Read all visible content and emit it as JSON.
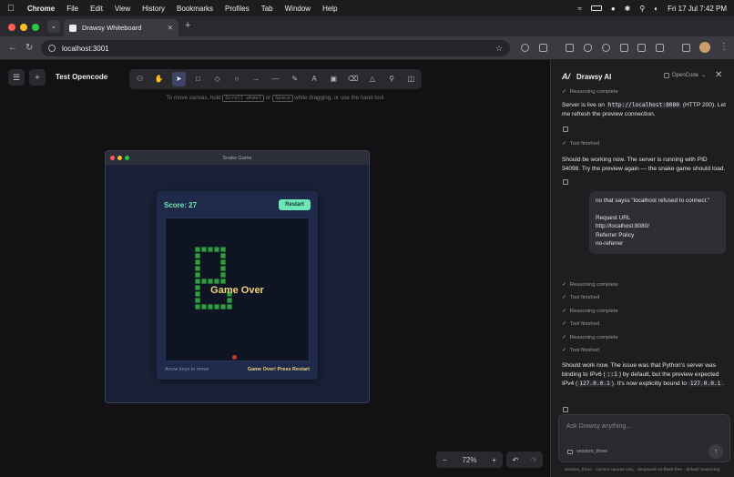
{
  "menubar": {
    "app": "Chrome",
    "items": [
      "File",
      "Edit",
      "View",
      "History",
      "Bookmarks",
      "Profiles",
      "Tab",
      "Window",
      "Help"
    ],
    "datetime": "Fri 17 Jul  7:42 PM"
  },
  "browser": {
    "tab_title": "Drawsy Whiteboard",
    "url": "localhost:3001"
  },
  "canvas": {
    "project_name": "Test Opencode",
    "hint_parts": [
      "To move canvas, hold ",
      "Scroll wheel",
      " or ",
      "Space",
      " while dragging, or use the hand tool"
    ],
    "zoom_level": "72%",
    "tools": [
      "lock",
      "hand",
      "select",
      "rectangle",
      "diamond",
      "ellipse",
      "arrow",
      "line",
      "pencil",
      "text",
      "image",
      "eraser",
      "library",
      "search",
      "split"
    ]
  },
  "game_window": {
    "title": "Snake Game",
    "score_label": "Score: 27",
    "restart_label": "Restart",
    "game_over_text": "Game Over",
    "controls_hint": "Arrow keys to move",
    "status_text": "Game Over! Press Restart"
  },
  "ai_panel": {
    "title": "Drawsy AI",
    "model_chip": "OpenCode",
    "status_top": "Reasoning complete",
    "msg1_parts": [
      "Server is live on ",
      "http://localhost:8080",
      " (HTTP 200). Let me refresh the preview connection."
    ],
    "tool_finished": "Tool finished",
    "msg2": "Should be working now. The server is running with PID 34098. Try the preview again — the snake game should load.",
    "user_lines": [
      "no that sayss \"localhost refused to connect.\"",
      "",
      "Request URL",
      "http://localhost:8080/",
      "Referrer Policy",
      "no-referrer"
    ],
    "status_list": [
      "Reasoning complete",
      "Tool finished",
      "Reasoning complete",
      "Tool finished",
      "Reasoning complete",
      "Tool finished"
    ],
    "msg3_parts": [
      "Should work now. The issue was that Python's server was binding to IPv6 (",
      "::1",
      ") by default, but the preview expected IPv4 (",
      "127.0.0.1",
      "). It's now explicitly bound to ",
      "127.0.0.1",
      "."
    ],
    "input_placeholder": "Ask Drawsy anything...",
    "session_name": "session_three",
    "footer": "session_three · current canvas only  ·  deepseek-v4-flash-free · default reasoning"
  }
}
